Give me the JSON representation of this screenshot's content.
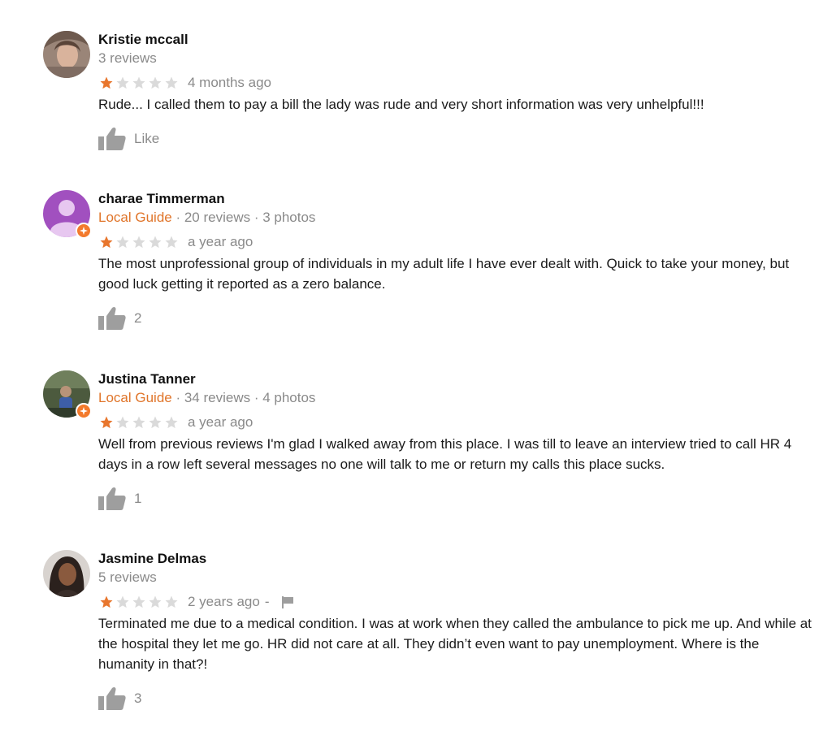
{
  "reviews": [
    {
      "name": "Kristie mccall",
      "meta_plain": "3 reviews",
      "is_local_guide": false,
      "rating": 1,
      "max_rating": 5,
      "time": "4 months ago",
      "text": "Rude... I called them to pay a bill the lady was rude and very short information  was very unhelpful!!!",
      "like_label": "Like"
    },
    {
      "name": "charae Timmerman",
      "guide_label": "Local Guide",
      "meta_rest": " · 20 reviews · 3 photos",
      "is_local_guide": true,
      "rating": 1,
      "max_rating": 5,
      "time": "a year ago",
      "text": "The most unprofessional group of individuals  in my adult life I have ever dealt  with. Quick to take your money, but good luck getting it reported as a zero balance.",
      "like_label": "2"
    },
    {
      "name": "Justina Tanner",
      "guide_label": "Local Guide",
      "meta_rest": " · 34 reviews · 4 photos",
      "is_local_guide": true,
      "rating": 1,
      "max_rating": 5,
      "time": "a year ago",
      "text": "Well from previous reviews I'm glad I walked away from this place.  I was till to leave an interview tried to call HR 4 days in a row left several messages no one will talk to me or return my calls this place sucks.",
      "like_label": "1"
    },
    {
      "name": "Jasmine Delmas",
      "meta_plain": "5 reviews",
      "is_local_guide": false,
      "rating": 1,
      "max_rating": 5,
      "time": "2 years ago",
      "time_suffix": "-",
      "text": "Terminated me due to a medical condition. I was at work when they called the ambulance to pick me up. And while at the hospital they let me go. HR did not care at all. They didn’t even want to pay unemployment. Where is the humanity in that?!",
      "like_label": "3"
    }
  ],
  "colors": {
    "star_filled": "#e8762d",
    "star_empty": "#dadada",
    "local_guide": "#e0752a",
    "muted": "#8a8a8a",
    "icon_gray": "#9e9e9e"
  }
}
